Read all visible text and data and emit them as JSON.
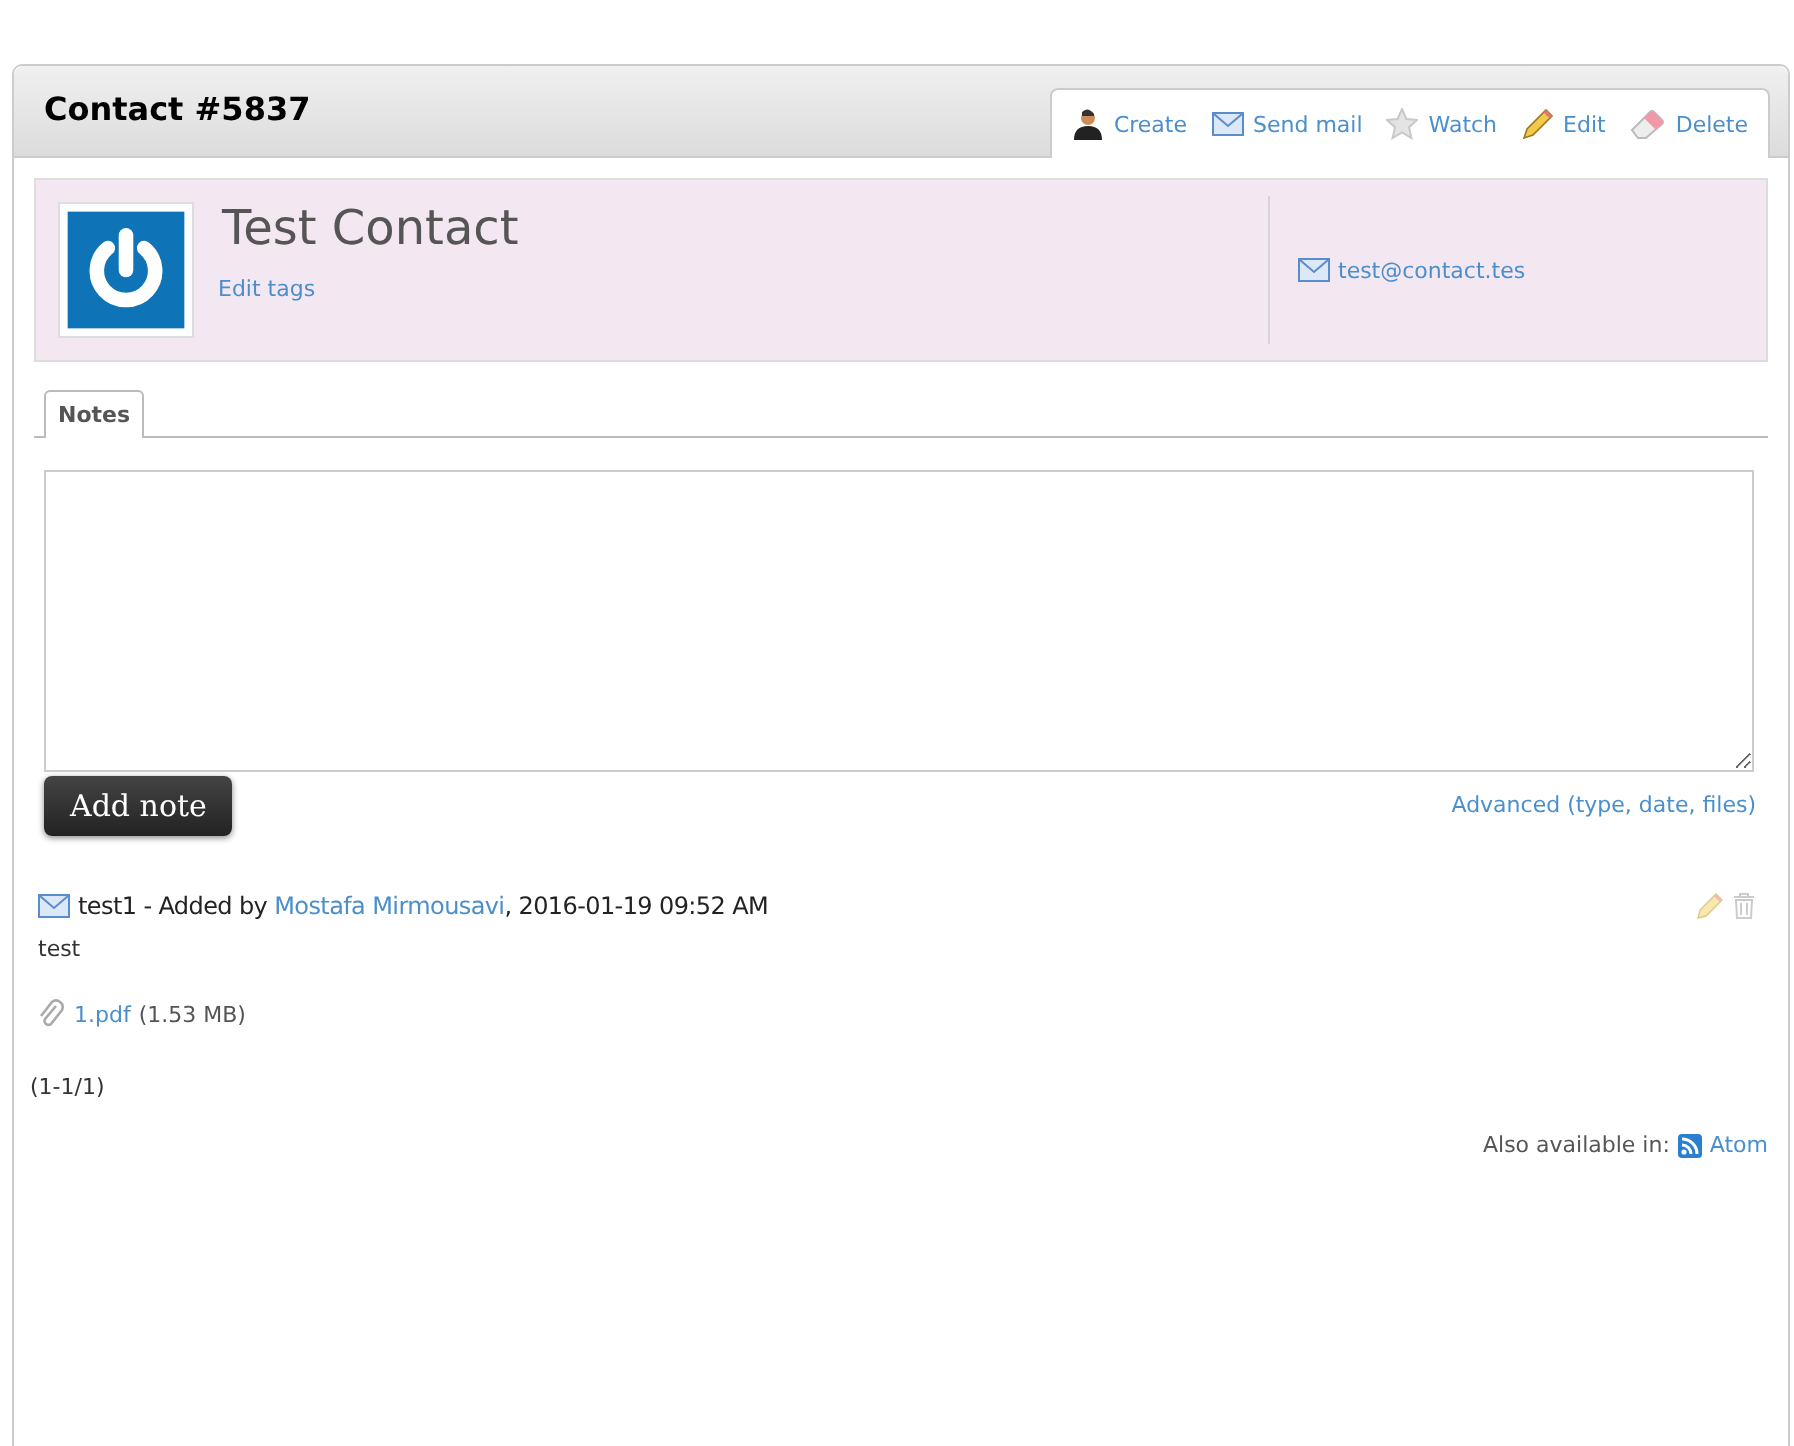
{
  "title": "Contact #5837",
  "actions": [
    {
      "kind": "person",
      "label": "Create"
    },
    {
      "kind": "mail",
      "label": "Send mail"
    },
    {
      "kind": "star",
      "label": "Watch"
    },
    {
      "kind": "pencil",
      "label": "Edit"
    },
    {
      "kind": "eraser",
      "label": "Delete"
    }
  ],
  "contact": {
    "name": "Test Contact",
    "edit_tags": "Edit tags",
    "email": "test@contact.tes"
  },
  "tabs": [
    {
      "label": "Notes",
      "selected": true
    }
  ],
  "note_form": {
    "button": "Add note",
    "advanced_link": "Advanced (type, date, files)"
  },
  "notes": [
    {
      "prefix": "test1 - Added by",
      "author": "Mostafa Mirmousavi",
      "suffix": ", 2016-01-19 09:52 AM",
      "body": "test",
      "attachment": {
        "name": "1.pdf",
        "size": "(1.53 MB)"
      }
    }
  ],
  "pagination": "(1-1/1)",
  "footer": {
    "label": "Also available in:",
    "link": "Atom"
  }
}
